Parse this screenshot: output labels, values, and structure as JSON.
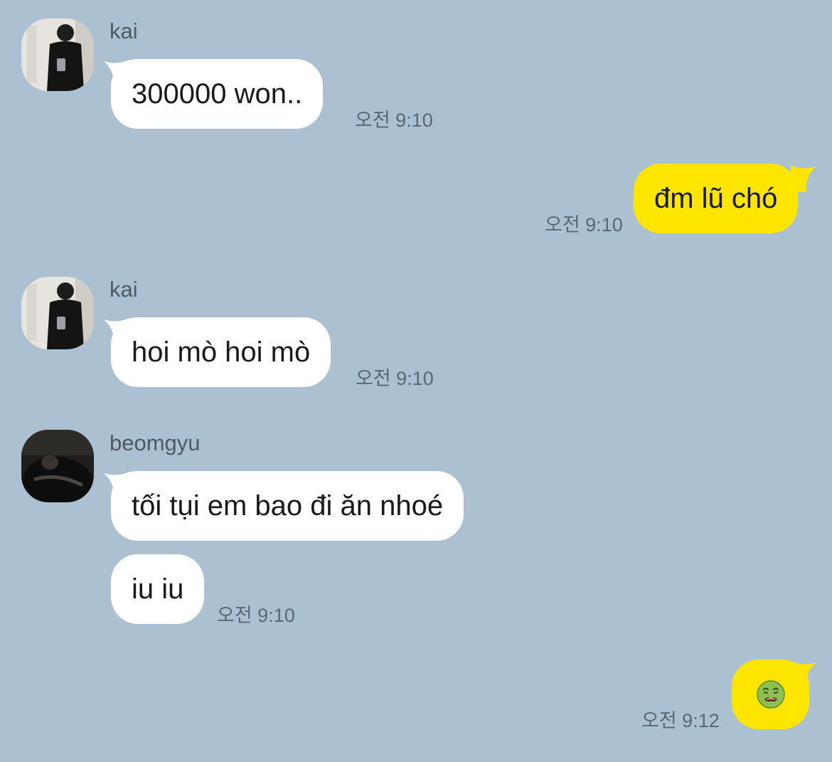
{
  "messages": [
    {
      "sender": "kai",
      "text": "300000 won..",
      "time": "오전 9:10"
    },
    {
      "text": "đm lũ chó",
      "time": "오전 9:10"
    },
    {
      "sender": "kai",
      "text": "hoi mò hoi mò",
      "time": "오전 9:10"
    },
    {
      "sender": "beomgyu",
      "texts": [
        "tối tụi em bao đi ăn nhoé",
        "iu iu"
      ],
      "time": "오전 9:10"
    },
    {
      "emoji": "nauseated-face-icon",
      "time": "오전 9:12"
    }
  ],
  "colors": {
    "background": "#abc1d1",
    "incoming_bubble": "#ffffff",
    "outgoing_bubble": "#fee500"
  }
}
